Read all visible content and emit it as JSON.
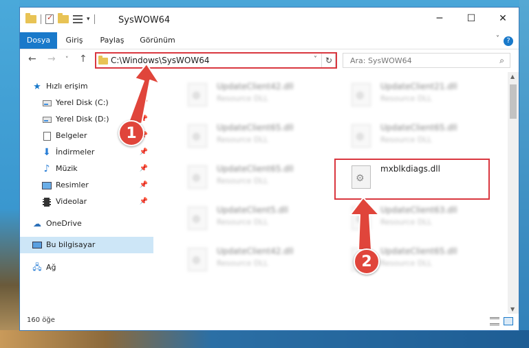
{
  "window": {
    "title": "SysWOW64",
    "minimize_icon": "minimize-icon",
    "maximize_icon": "maximize-icon",
    "close_icon": "close-icon"
  },
  "ribbon": {
    "tabs": [
      {
        "label": "Dosya",
        "active": true
      },
      {
        "label": "Giriş"
      },
      {
        "label": "Paylaş"
      },
      {
        "label": "Görünüm"
      }
    ],
    "help": "?"
  },
  "navbar": {
    "address": "C:\\Windows\\SysWOW64",
    "search_placeholder": "Ara: SysWOW64"
  },
  "sidebar": {
    "items": [
      {
        "label": "Hızlı erişim",
        "icon": "star-icon"
      },
      {
        "label": "Yerel Disk (C:)",
        "icon": "drive-icon",
        "pinned": true
      },
      {
        "label": "Yerel Disk (D:)",
        "icon": "drive-icon",
        "pinned": true
      },
      {
        "label": "Belgeler",
        "icon": "document-icon",
        "pinned": true
      },
      {
        "label": "İndirmeler",
        "icon": "download-icon",
        "pinned": true
      },
      {
        "label": "Müzik",
        "icon": "music-icon",
        "pinned": true
      },
      {
        "label": "Resimler",
        "icon": "pictures-icon",
        "pinned": true
      },
      {
        "label": "Videolar",
        "icon": "videos-icon",
        "pinned": true
      },
      {
        "label": "OneDrive",
        "icon": "cloud-icon"
      },
      {
        "label": "Bu bilgisayar",
        "icon": "computer-icon",
        "selected": true
      },
      {
        "label": "Ağ",
        "icon": "network-icon"
      }
    ]
  },
  "files": [
    {
      "name": "UpdateClient42.dll",
      "type": "Resource DLL",
      "blurred": true
    },
    {
      "name": "UpdateClient21.dll",
      "type": "Resource DLL",
      "blurred": true
    },
    {
      "name": "UpdateClient65.dll",
      "type": "Resource DLL",
      "blurred": true
    },
    {
      "name": "UpdateClient65.dll",
      "type": "Resource DLL",
      "blurred": true
    },
    {
      "name": "UpdateClient65.dll",
      "type": "Resource DLL",
      "blurred": true
    },
    {
      "name": "mxblkdiags.dll",
      "type": "",
      "blurred": false
    },
    {
      "name": "UpdateClient5.dll",
      "type": "Resource DLL",
      "blurred": true
    },
    {
      "name": "UpdateClient63.dll",
      "type": "Resource DLL",
      "blurred": true
    },
    {
      "name": "UpdateClient42.dll",
      "type": "Resource DLL",
      "blurred": true
    },
    {
      "name": "UpdateClient65.dll",
      "type": "Resource DLL",
      "blurred": true
    }
  ],
  "status": {
    "item_count": "160 öğe"
  },
  "callouts": {
    "first": "1",
    "second": "2"
  },
  "colors": {
    "accent": "#1979ca",
    "highlight": "#d9363e",
    "callout": "#e0453b"
  }
}
